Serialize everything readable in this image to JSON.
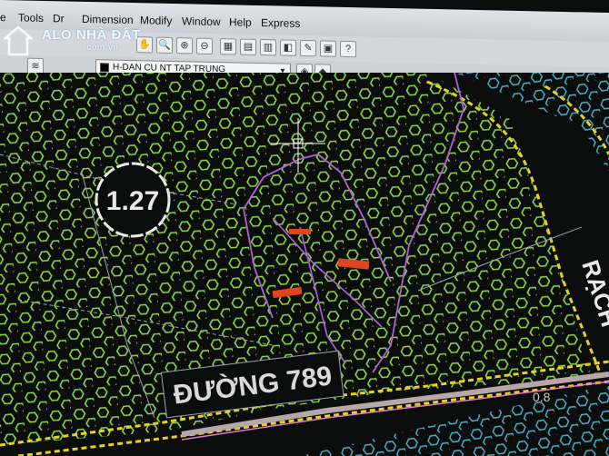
{
  "menu": {
    "items": [
      {
        "key": "partial1",
        "label": "e"
      },
      {
        "key": "tools",
        "label": "Tools"
      },
      {
        "key": "draw",
        "label": "Dr"
      },
      {
        "key": "dimension",
        "label": "Dimension"
      },
      {
        "key": "modify",
        "label": "Modify"
      },
      {
        "key": "window",
        "label": "Window"
      },
      {
        "key": "help",
        "label": "Help"
      },
      {
        "key": "express",
        "label": "Express"
      }
    ]
  },
  "toolbar": {
    "icons": [
      "pan-icon",
      "zoom-realtime-icon",
      "zoom-window-icon",
      "zoom-previous-icon",
      "properties-icon",
      "design-center-icon",
      "tool-palettes-icon",
      "sheet-set-icon",
      "markup-icon",
      "calculator-icon",
      "help-icon"
    ],
    "help_label": "?"
  },
  "layer_bar": {
    "current_layer": "H-DAN CU NT TAP TRUNG",
    "dropdown_arrow": "▼"
  },
  "watermark": {
    "brand": "ALO NHÀ ĐẤT",
    "domain": ".com.vn"
  },
  "drawing": {
    "circle_label": "1.27",
    "road_label": "ĐƯỜNG 789",
    "canal_label": "RẠCH",
    "dimension_label": "0.8",
    "colors": {
      "background": "#0b0d0c",
      "hatch": "#8fd84a",
      "boundary": "#e6d21f",
      "parcel": "#b05fd6",
      "marker": "#e0441e",
      "text": "#e8e8e8",
      "crosshair": "#ffffff",
      "road_band": "#b6a7a9"
    }
  }
}
